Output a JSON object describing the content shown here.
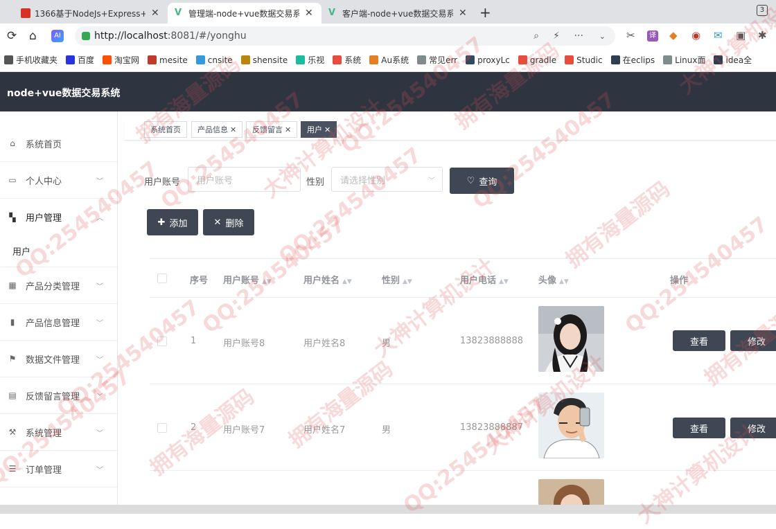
{
  "browser": {
    "tabs": [
      {
        "title": "1366基于NodeJs+Express+",
        "active": false,
        "icon_color": "#d93025"
      },
      {
        "title": "管理端-node+vue数据交易系",
        "active": true,
        "icon_color": "#42b883"
      },
      {
        "title": "客户端-node+vue数据交易系",
        "active": false,
        "icon_color": "#42b883"
      }
    ],
    "tab_count": "3",
    "url_host": "http://localhost",
    "url_rest": ":8081/#/yonghu",
    "bookmarks": [
      {
        "label": "手机收藏夹",
        "color": "#555"
      },
      {
        "label": "百度",
        "color": "#2932e1"
      },
      {
        "label": "淘宝网",
        "color": "#ff5000"
      },
      {
        "label": "mesite",
        "color": "#c0392b"
      },
      {
        "label": "cnsite",
        "color": "#3498db"
      },
      {
        "label": "shensite",
        "color": "#b8860b"
      },
      {
        "label": "乐视",
        "color": "#1abc9c"
      },
      {
        "label": "系统",
        "color": "#e74c3c"
      },
      {
        "label": "Au系统",
        "color": "#e67e22"
      },
      {
        "label": "常见err",
        "color": "#7f8c8d"
      },
      {
        "label": "proxyLc",
        "color": "#34495e"
      },
      {
        "label": "gradle",
        "color": "#e74c3c"
      },
      {
        "label": "Studic",
        "color": "#e74c3c"
      },
      {
        "label": "在eclips",
        "color": "#2c3e50"
      },
      {
        "label": "Linux面",
        "color": "#7f8c8d"
      },
      {
        "label": "idea全",
        "color": "#2c3e50"
      }
    ]
  },
  "app": {
    "title": "node+vue数据交易系统",
    "menu": [
      {
        "label": "系统首页",
        "icon": "home-icon",
        "has_children": false
      },
      {
        "label": "个人中心",
        "icon": "id-card-icon",
        "has_children": true
      },
      {
        "label": "用户管理",
        "icon": "grid-icon",
        "has_children": true,
        "expanded": true
      },
      {
        "label": "产品分类管理",
        "icon": "apps-icon",
        "has_children": true
      },
      {
        "label": "产品信息管理",
        "icon": "bar-chart-icon",
        "has_children": true
      },
      {
        "label": "数据文件管理",
        "icon": "flag-icon",
        "has_children": true
      },
      {
        "label": "反馈留言管理",
        "icon": "clipboard-icon",
        "has_children": true
      },
      {
        "label": "系统管理",
        "icon": "tools-icon",
        "has_children": true
      },
      {
        "label": "订单管理",
        "icon": "list-icon",
        "has_children": true
      }
    ],
    "submenu": {
      "label": "用户"
    },
    "tags": [
      {
        "label": "系统首页",
        "closable": false,
        "active": false
      },
      {
        "label": "产品信息",
        "closable": true,
        "active": false
      },
      {
        "label": "反馈留言",
        "closable": true,
        "active": false
      },
      {
        "label": "用户",
        "closable": true,
        "active": true
      }
    ],
    "search": {
      "account_label": "用户账号",
      "account_placeholder": "用户账号",
      "gender_label": "性别",
      "gender_placeholder": "请选择性别",
      "query_button": "查询"
    },
    "actions": {
      "add": "添加",
      "delete": "删除"
    },
    "table": {
      "columns": [
        "序号",
        "用户账号",
        "用户姓名",
        "性别",
        "用户电话",
        "头像",
        "操作"
      ],
      "rows": [
        {
          "index": "1",
          "account": "用户账号8",
          "name": "用户姓名8",
          "gender": "男",
          "phone": "13823888888",
          "avatar": "female-portrait"
        },
        {
          "index": "2",
          "account": "用户账号7",
          "name": "用户姓名7",
          "gender": "男",
          "phone": "13823888887",
          "avatar": "cartoon-male-selfie"
        },
        {
          "index": "",
          "account": "",
          "name": "",
          "gender": "",
          "phone": "",
          "avatar": "female-portrait-2"
        }
      ],
      "view_button": "查看",
      "edit_button": "修改"
    },
    "watermarks": [
      "QQ:254540457",
      "大神计算机设计",
      "拥有海量源码"
    ]
  }
}
